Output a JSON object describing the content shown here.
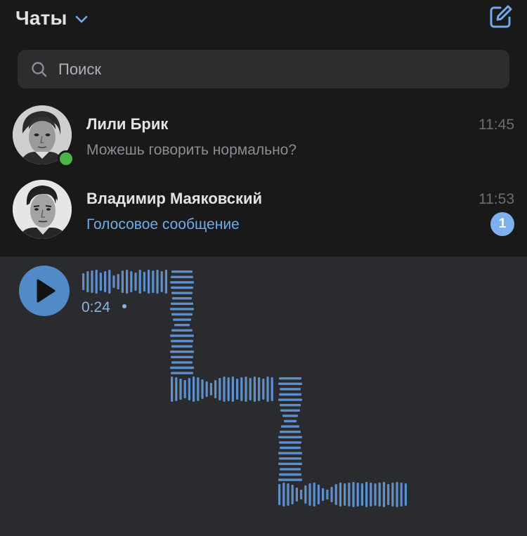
{
  "header": {
    "title": "Чаты",
    "icons": {
      "dropdown": "chevron-down-icon",
      "compose": "compose-icon"
    }
  },
  "search": {
    "placeholder": "Поиск",
    "value": "",
    "icon": "search-icon"
  },
  "chats": [
    {
      "name": "Лили Брик",
      "time": "11:45",
      "last_message": "Можешь говорить нормально?",
      "online": true,
      "unread": null
    },
    {
      "name": "Владимир Маяковский",
      "time": "11:53",
      "last_message": "Голосовое сообщение",
      "online": false,
      "unread": "1"
    }
  ],
  "voice_message": {
    "duration": "0:24",
    "unplayed": true,
    "icon": "play-icon"
  },
  "colors": {
    "list_background": "#19191a",
    "chat_background": "#2a2b2e",
    "accent": "#71aaeb",
    "waveform": "#5f8fcb",
    "online": "#4bb34b",
    "play_button": "#5289c7"
  }
}
